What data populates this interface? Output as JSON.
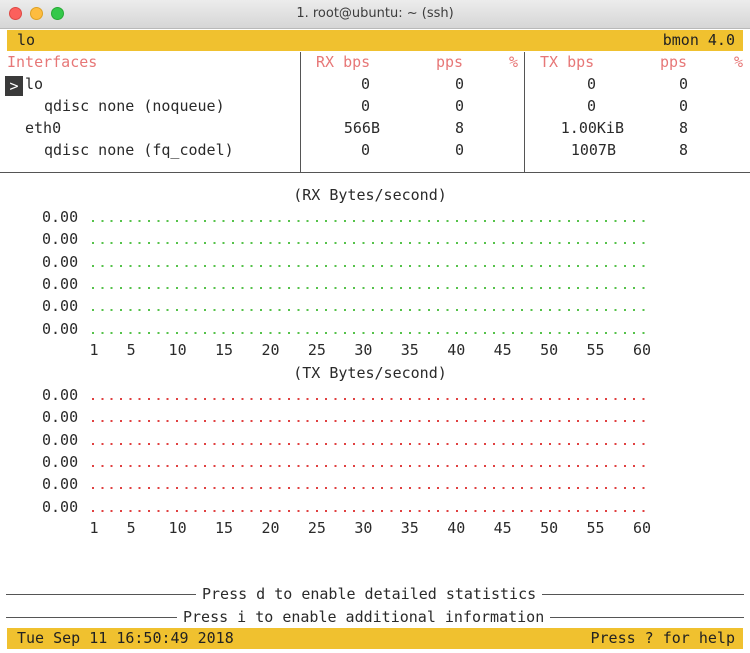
{
  "window": {
    "title": "1. root@ubuntu: ~ (ssh)"
  },
  "topbar": {
    "left": "lo",
    "right": "bmon 4.0"
  },
  "table": {
    "headers": {
      "interfaces": "Interfaces",
      "rx_bps": "RX bps",
      "rx_pps": "pps",
      "rx_pct": "%",
      "tx_bps": "TX bps",
      "tx_pps": "pps",
      "tx_pct": "%"
    },
    "selector": ">",
    "rows": [
      {
        "name": "lo",
        "rx_bps": "0",
        "rx_pps": "0",
        "tx_bps": "0",
        "tx_pps": "0"
      },
      {
        "name": "qdisc none (noqueue)",
        "rx_bps": "0",
        "rx_pps": "0",
        "tx_bps": "0",
        "tx_pps": "0"
      },
      {
        "name": "eth0",
        "rx_bps": "566B",
        "rx_pps": "8",
        "tx_bps": "1.00KiB",
        "tx_pps": "8"
      },
      {
        "name": "qdisc none (fq_codel)",
        "rx_bps": "0",
        "rx_pps": "0",
        "tx_bps": "1007B",
        "tx_pps": "8"
      }
    ]
  },
  "graphs": {
    "rx": {
      "title": "(RX Bytes/second)",
      "y_labels": [
        "0.00",
        "0.00",
        "0.00",
        "0.00",
        "0.00",
        "0.00"
      ],
      "color": "#55c24a"
    },
    "tx": {
      "title": "(TX Bytes/second)",
      "y_labels": [
        "0.00",
        "0.00",
        "0.00",
        "0.00",
        "0.00",
        "0.00"
      ],
      "color": "#e04040"
    },
    "x_ticks": [
      "1",
      "5",
      "10",
      "15",
      "20",
      "25",
      "30",
      "35",
      "40",
      "45",
      "50",
      "55",
      "60"
    ]
  },
  "footer": {
    "detailed": "Press d to enable detailed statistics",
    "additional": "Press i to enable additional information"
  },
  "statusbar": {
    "datetime": "Tue Sep 11 16:50:49 2018",
    "help": "Press ? for help"
  }
}
